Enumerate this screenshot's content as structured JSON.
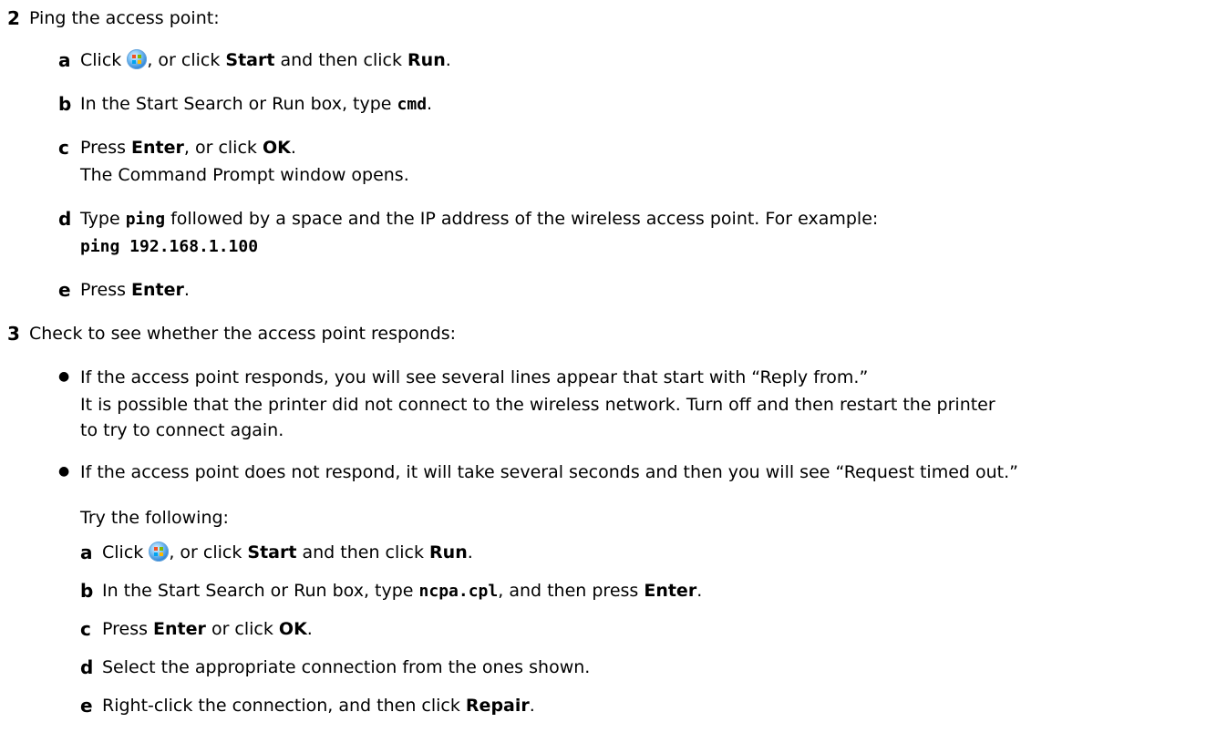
{
  "step2": {
    "number": "2",
    "title": "Ping the access point:",
    "a": {
      "letter": "a",
      "t1": "Click ",
      "t2": ", or click ",
      "b1": "Start",
      "t3": " and then click ",
      "b2": "Run",
      "t4": "."
    },
    "b": {
      "letter": "b",
      "t1": "In the Start Search or Run box, type ",
      "c1": "cmd",
      "t2": "."
    },
    "c": {
      "letter": "c",
      "t1": "Press ",
      "b1": "Enter",
      "t2": ", or click ",
      "b2": "OK",
      "t3": ".",
      "note": "The Command Prompt window opens."
    },
    "d": {
      "letter": "d",
      "t1": "Type ",
      "c1": "ping",
      "t2": " followed by a space and the IP address of the wireless access point. For example:",
      "example": "ping 192.168.1.100"
    },
    "e": {
      "letter": "e",
      "t1": "Press ",
      "b1": "Enter",
      "t2": "."
    }
  },
  "step3": {
    "number": "3",
    "title": "Check to see whether the access point responds:",
    "bullet1": {
      "line1": "If the access point responds, you will see several lines appear that start with “Reply from.”",
      "line2": "It is possible that the printer did not connect to the wireless network. Turn off and then restart the printer",
      "line3": "to try to connect again."
    },
    "bullet2": {
      "line1": "If the access point does not respond, it will take several seconds and then you will see “Request timed out.”",
      "try": "Try the following:"
    },
    "a": {
      "letter": "a",
      "t1": "Click ",
      "t2": ", or click ",
      "b1": "Start",
      "t3": " and then click ",
      "b2": "Run",
      "t4": "."
    },
    "b": {
      "letter": "b",
      "t1": "In the Start Search or Run box, type ",
      "c1": "ncpa.cpl",
      "t2": ", and then press ",
      "b1": "Enter",
      "t3": "."
    },
    "c": {
      "letter": "c",
      "t1": "Press ",
      "b1": "Enter",
      "t2": " or click ",
      "b2": "OK",
      "t3": "."
    },
    "d": {
      "letter": "d",
      "t1": "Select the appropriate connection from the ones shown."
    },
    "e": {
      "letter": "e",
      "t1": "Right-click the connection, and then click ",
      "b1": "Repair",
      "t2": "."
    }
  },
  "icons": {
    "start_orb": "windows-start-orb-icon"
  }
}
